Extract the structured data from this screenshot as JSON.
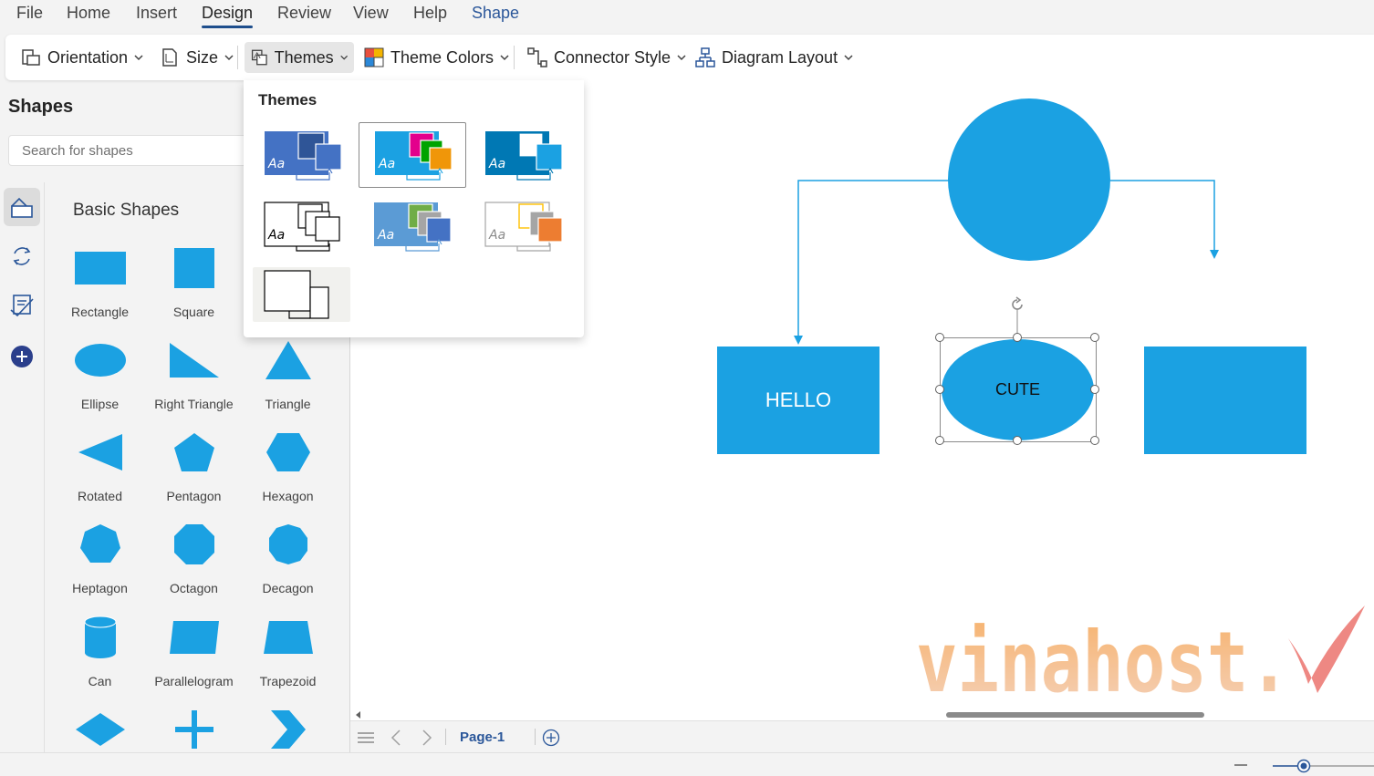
{
  "menu": {
    "items": [
      "File",
      "Home",
      "Insert",
      "Design",
      "Review",
      "View",
      "Help",
      "Shape"
    ],
    "active": "Design"
  },
  "ribbon": {
    "orientation": "Orientation",
    "size": "Size",
    "themes": "Themes",
    "theme_colors": "Theme Colors",
    "connector_style": "Connector Style",
    "diagram_layout": "Diagram Layout"
  },
  "themes_panel": {
    "title": "Themes",
    "themes": [
      {
        "sample": "Aa",
        "colors": [
          "#4472c4",
          "#2f5597",
          "#4472c4"
        ]
      },
      {
        "sample": "Aa",
        "colors": [
          "#1ba1e2",
          "#e3008c",
          "#00a300",
          "#f09609"
        ],
        "selected": true
      },
      {
        "sample": "Aa",
        "colors": [
          "#0078b4",
          "#ffffff",
          "#0078b4"
        ]
      },
      {
        "sample": "Aa",
        "colors": [
          "#ffffff",
          "#000000"
        ]
      },
      {
        "sample": "Aa",
        "colors": [
          "#5b9bd5",
          "#70ad47",
          "#a5a5a5",
          "#4472c4"
        ]
      },
      {
        "sample": "Aa",
        "colors": [
          "#ffffff",
          "#ffc000",
          "#ed7d31"
        ]
      },
      {
        "sample": "",
        "colors": [
          "#ffffff",
          "#000000"
        ]
      }
    ]
  },
  "shapes_panel": {
    "title": "Shapes",
    "search_placeholder": "Search for shapes",
    "section": "Basic Shapes",
    "shapes": [
      "Rectangle",
      "Square",
      "",
      "Ellipse",
      "Right Triangle",
      "Triangle",
      "Rotated",
      "Pentagon",
      "Hexagon",
      "Heptagon",
      "Octagon",
      "Decagon",
      "Can",
      "Parallelogram",
      "Trapezoid",
      "",
      "",
      ""
    ]
  },
  "diagram": {
    "left_box_text": "HELLO",
    "ellipse_text": "CUTE",
    "right_box_text": "",
    "fill_color": "#1ba1e2"
  },
  "page_tabs": {
    "current": "Page-1"
  },
  "watermark": {
    "text": "vinahost.vn"
  },
  "colors": {
    "accent": "#2b579a",
    "shape_fill": "#1ba1e2"
  }
}
